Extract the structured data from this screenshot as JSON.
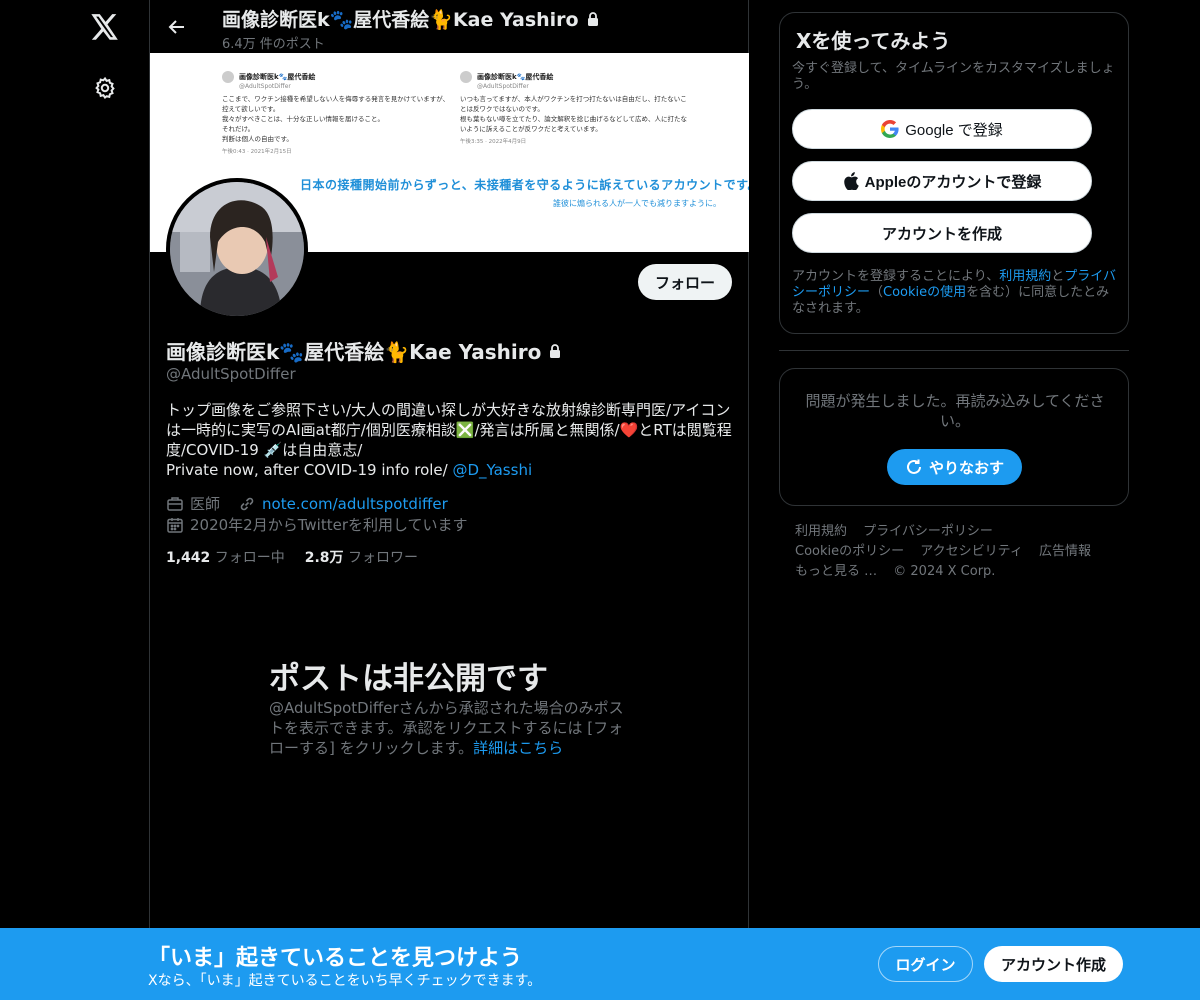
{
  "profile": {
    "name": "画像診断医k🐾屋代香絵🐈Kae Yashiro",
    "post_count": "6.4万 件のポスト",
    "handle": "@AdultSpotDiffer",
    "bio_text": "トップ画像をご参照下さい/大人の間違い探しが大好きな放射線診断専門医/アイコンは一時的に実写のAI画at都庁/個別医療相談❎/発言は所属と無関係/❤️とRTは閲覧程度/COVID-19 💉は自由意志/\nPrivate now, after COVID-19 info role/ ",
    "bio_link": "@D_Yasshi",
    "occupation": "医師",
    "website": "note.com/adultspotdiffer",
    "joined": "2020年2月からTwitterを利用しています",
    "following_count": "1,442",
    "following_label": "フォロー中",
    "followers_count": "2.8万",
    "followers_label": "フォロワー",
    "follow_button": "フォロー"
  },
  "banner": {
    "card1": {
      "name": "画像診断医k🐾屋代香絵",
      "handle": "@AdultSpotDiffer",
      "text": "ここまで、ワクチン接種を希望しない人を侮辱する発言を見かけていますが、控えて欲しいです。\n我々がすべきことは、十分な正しい情報を届けること。\nそれだけ。\n判断は個人の自由です。",
      "date": "午後0:43 · 2021年2月15日"
    },
    "card2": {
      "name": "画像診断医k🐾屋代香絵",
      "handle": "@AdultSpotDiffer",
      "text": "いつも言ってますが、本人がワクチンを打つ打たないは自由だし、打たないことは反ワクではないのです。\n根も葉もない噂を立てたり、論文解釈を捻じ曲げるなどして広め、人に打たないように訴えることが反ワクだと考えています。",
      "date": "午後3:35 · 2022年4月9日"
    },
    "headline": "日本の接種開始前からずっと、未接種者を守るように訴えているアカウントです。",
    "subline": "誰彼に煽られる人が一人でも減りますように。"
  },
  "private_notice": {
    "title": "ポストは非公開です",
    "description": "@AdultSpotDifferさんから承認された場合のみポストを表示できます。承認をリクエストするには [フォローする] をクリックします。",
    "link": "詳細はこちら"
  },
  "signup": {
    "title": "Xを使ってみよう",
    "subtitle": "今すぐ登録して、タイムラインをカスタマイズしましょう。",
    "google_button": "Google で登録",
    "apple_button": "Appleのアカウントで登録",
    "create_button": "アカウントを作成",
    "legal_prefix": "アカウントを登録することにより、",
    "legal_terms": "利用規約",
    "legal_and": "と",
    "legal_privacy": "プライバシーポリシー",
    "legal_mid": "（",
    "legal_cookie": "Cookieの使用",
    "legal_suffix": "を含む）に同意したとみなされます。"
  },
  "error": {
    "message": "問題が発生しました。再読み込みしてください。",
    "retry_button": "やりなおす"
  },
  "footer": {
    "links": [
      "利用規約",
      "プライバシーポリシー",
      "Cookieのポリシー",
      "アクセシビリティ",
      "広告情報",
      "もっと見る …",
      "© 2024 X Corp."
    ]
  },
  "bottom_bar": {
    "title": "「いま」起きていることを見つけよう",
    "subtitle": "Xなら、「いま」起きていることをいち早くチェックできます。",
    "login_button": "ログイン",
    "signup_button": "アカウント作成"
  },
  "colors": {
    "accent": "#1d9bf0",
    "background": "#000000",
    "muted": "#71767b",
    "border": "#2f3336"
  }
}
